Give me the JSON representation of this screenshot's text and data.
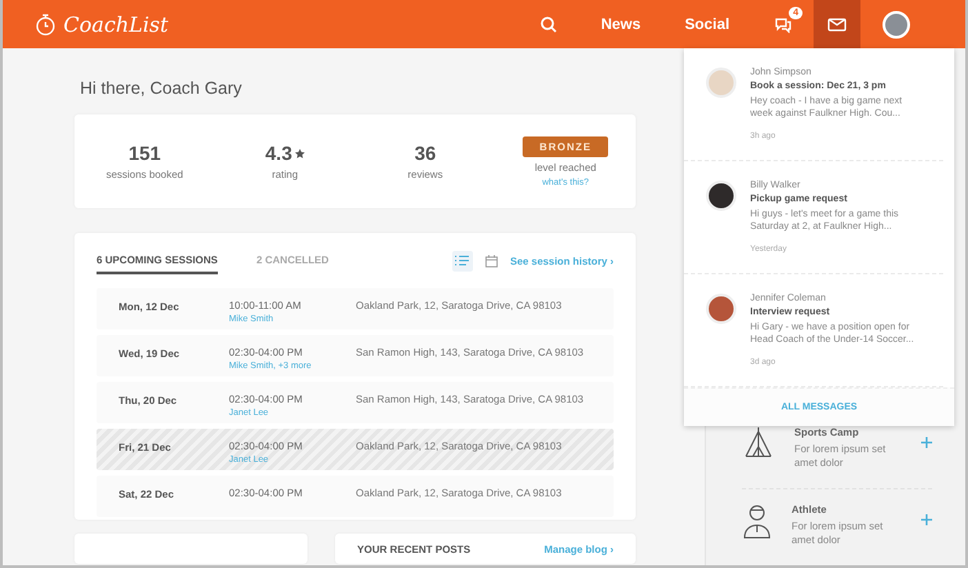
{
  "header": {
    "logo": "CoachList",
    "nav": [
      {
        "kind": "search",
        "selected": false
      },
      {
        "kind": "text",
        "label": "News",
        "selected": false
      },
      {
        "kind": "text",
        "label": "Social",
        "selected": false
      },
      {
        "kind": "notifications",
        "badge": "4",
        "selected": false
      },
      {
        "kind": "mail",
        "selected": true
      },
      {
        "kind": "avatar",
        "selected": false
      }
    ]
  },
  "greeting": "Hi there, Coach Gary",
  "stats": [
    {
      "kind": "number",
      "value": "151",
      "label": "sessions booked"
    },
    {
      "kind": "rating",
      "value": "4.3",
      "label": "rating"
    },
    {
      "kind": "number",
      "value": "36",
      "label": "reviews"
    },
    {
      "kind": "badge",
      "value": "BRONZE",
      "label": "level reached",
      "link": "what's this?"
    }
  ],
  "sessions": {
    "tabs": [
      {
        "label": "6 UPCOMING SESSIONS",
        "selected": true
      },
      {
        "label": "2 CANCELLED",
        "selected": false
      }
    ],
    "views": [
      {
        "kind": "list",
        "selected": true
      },
      {
        "kind": "calendar",
        "selected": false
      }
    ],
    "history_link": "See session history ›",
    "rows": [
      {
        "date": "Mon, 12 Dec",
        "time": "10:00-11:00 AM",
        "people": "Mike Smith",
        "place": "Oakland Park, 12, Saratoga Drive, CA 98103",
        "highlighted": false
      },
      {
        "date": "Wed, 19 Dec",
        "time": "02:30-04:00 PM",
        "people": "Mike Smith, +3 more",
        "place": "San Ramon High, 143, Saratoga Drive, CA 98103",
        "highlighted": false
      },
      {
        "date": "Thu, 20 Dec",
        "time": "02:30-04:00 PM",
        "people": "Janet Lee",
        "place": "San Ramon High, 143, Saratoga Drive, CA 98103",
        "highlighted": false
      },
      {
        "date": "Fri, 21 Dec",
        "time": "02:30-04:00 PM",
        "people": "Janet Lee",
        "place": "Oakland Park, 12, Saratoga Drive, CA 98103",
        "highlighted": true
      },
      {
        "date": "Sat, 22 Dec",
        "time": "02:30-04:00 PM",
        "place": "Oakland Park, 12, Saratoga Drive, CA 98103",
        "highlighted": false
      }
    ]
  },
  "posts": {
    "title": "YOUR RECENT POSTS",
    "link": "Manage blog ›"
  },
  "sidebar": [
    {
      "kind": "camp",
      "title": "Sports Camp",
      "text": "For lorem ipsum set amet dolor"
    },
    {
      "kind": "athlete",
      "title": "Athlete",
      "text": "For lorem ipsum set amet dolor"
    }
  ],
  "messages": {
    "items": [
      {
        "name": "John Simpson",
        "subject": "Book a session: Dec 21, 3 pm",
        "preview": "Hey coach - I have a big game next week against Faulkner High. Cou...",
        "time": "3h ago",
        "color": "#e8d6c4"
      },
      {
        "name": "Billy Walker",
        "subject": "Pickup game request",
        "preview": "Hi guys - let's meet for a game this Saturday at 2, at Faulkner High...",
        "time": "Yesterday",
        "color": "#2e2a2a"
      },
      {
        "name": "Jennifer Coleman",
        "subject": "Interview request",
        "preview": "Hi Gary - we have a position open for Head Coach of the Under-14 Soccer...",
        "time": "3d ago",
        "color": "#b5553a"
      }
    ],
    "footer": "ALL MESSAGES"
  }
}
